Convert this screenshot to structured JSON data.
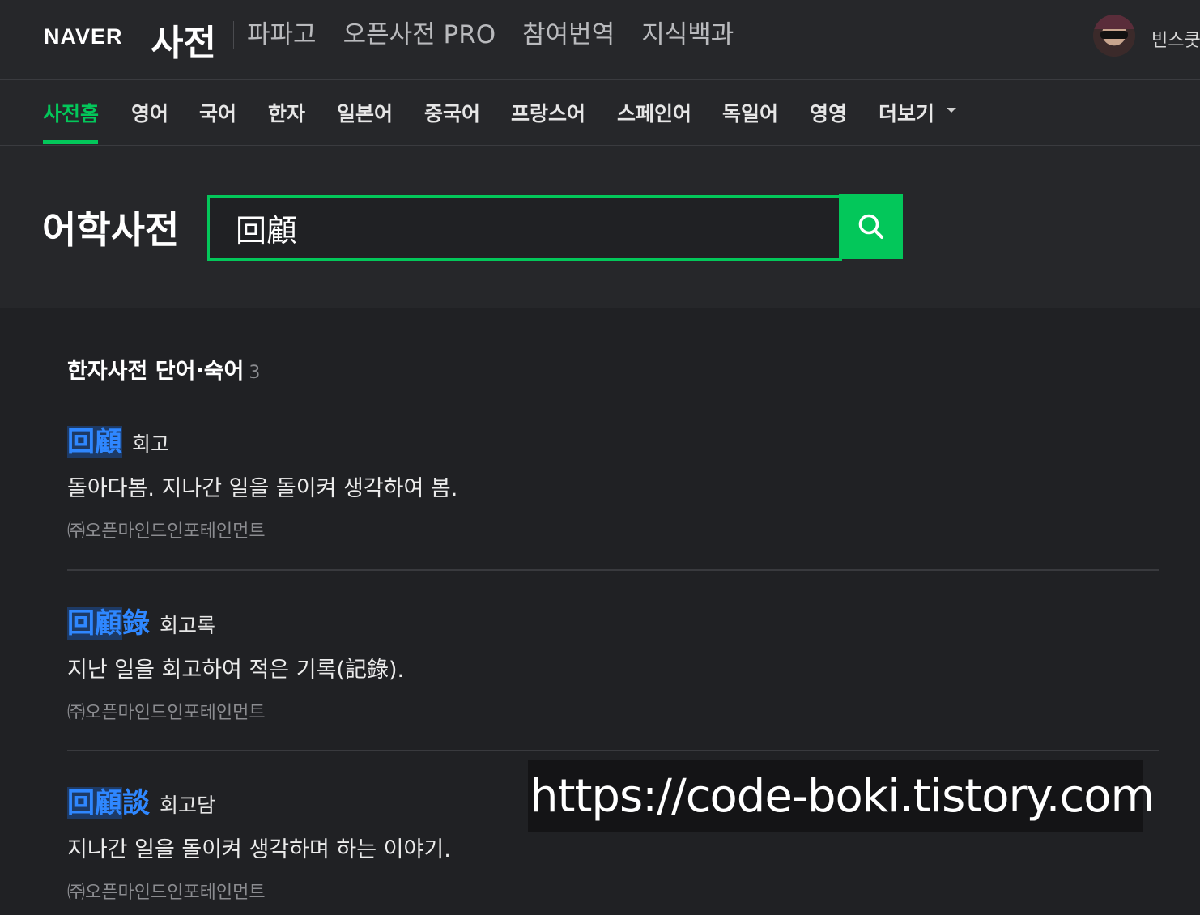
{
  "header": {
    "logo": "NAVER",
    "service_title": "사전",
    "links": [
      "파파고",
      "오픈사전 PRO",
      "참여번역",
      "지식백과"
    ],
    "username": "빈스쿳"
  },
  "tabs": {
    "items": [
      "사전홈",
      "영어",
      "국어",
      "한자",
      "일본어",
      "중국어",
      "프랑스어",
      "스페인어",
      "독일어",
      "영영",
      "더보기"
    ],
    "active": "사전홈"
  },
  "search": {
    "heading": "어학사전",
    "query": "回顧"
  },
  "results": {
    "section_title": "한자사전 단어·숙어",
    "count": "3",
    "entries": [
      {
        "hanja_match": "回顧",
        "hanja_rest": "",
        "reading": "회고",
        "meaning": "돌아다봄. 지나간 일을 돌이켜 생각하여 봄.",
        "source": "㈜오픈마인드인포테인먼트"
      },
      {
        "hanja_match": "回顧",
        "hanja_rest": "錄",
        "reading": "회고록",
        "meaning": "지난 일을 회고하여 적은 기록(記錄).",
        "source": "㈜오픈마인드인포테인먼트"
      },
      {
        "hanja_match": "回顧",
        "hanja_rest": "談",
        "reading": "회고담",
        "meaning": "지나간 일을 돌이켜 생각하며 하는 이야기.",
        "source": "㈜오픈마인드인포테인먼트"
      }
    ]
  },
  "watermark": "https://code-boki.tistory.com",
  "colors": {
    "accent": "#03c75a",
    "hanja_link": "#2f87ff",
    "background": "#202124"
  }
}
